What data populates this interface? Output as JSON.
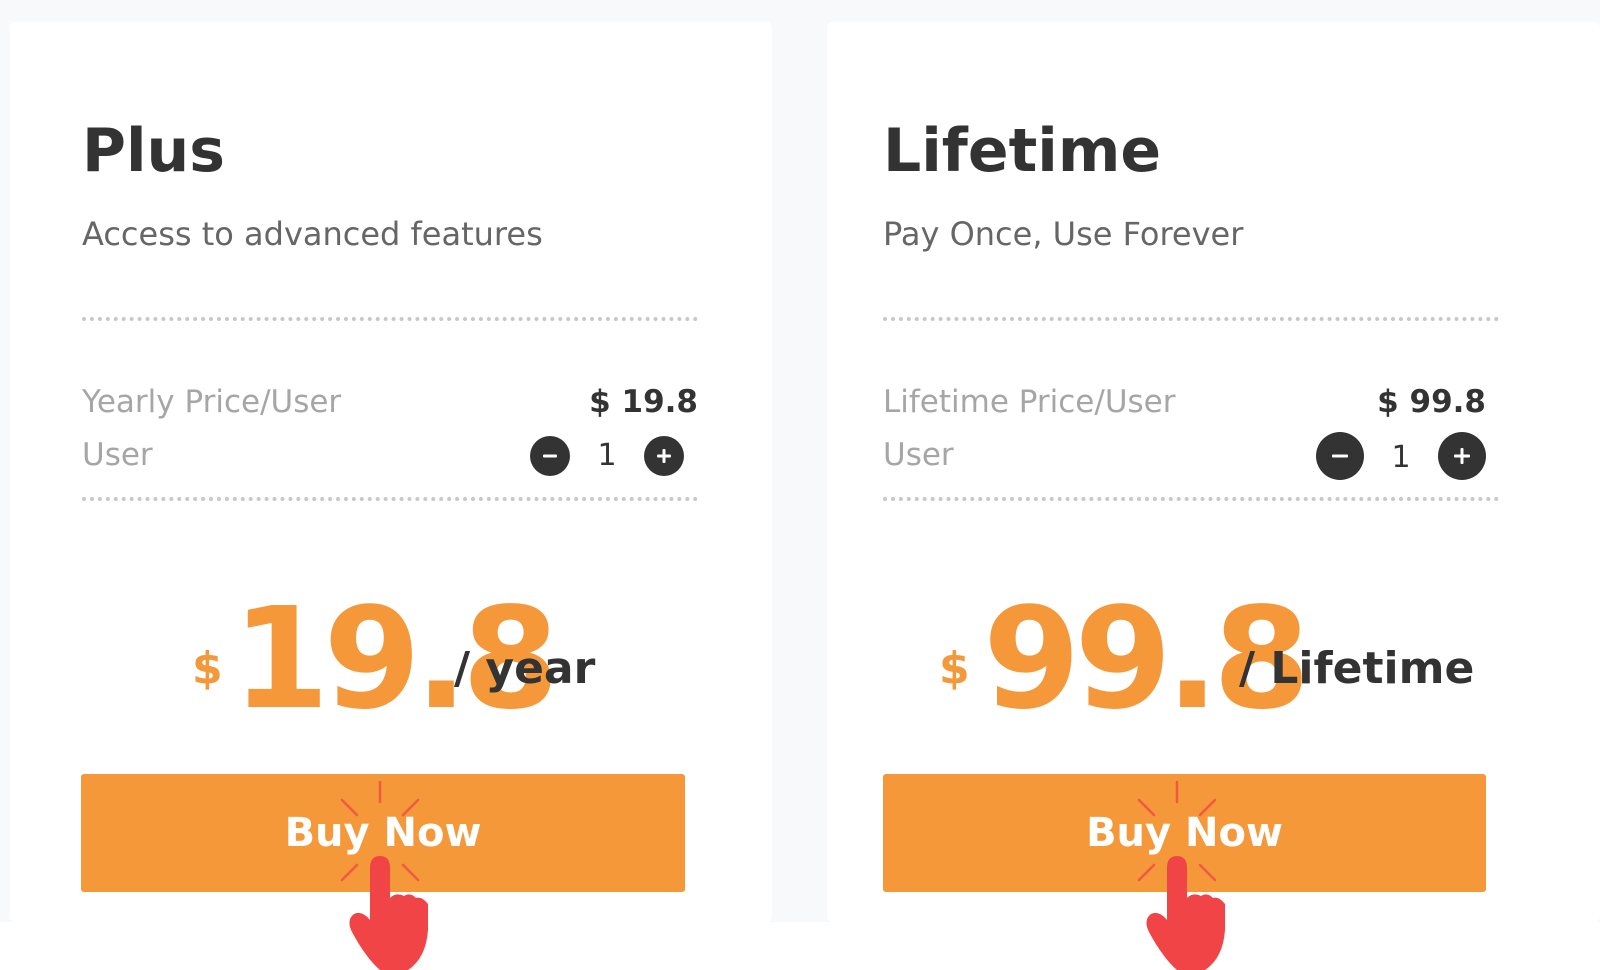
{
  "colors": {
    "accent": "#f4983a",
    "text_dark": "#333333",
    "text_muted": "#a6a6a6",
    "subtitle": "#666666",
    "pointer": "#f04446"
  },
  "plans": [
    {
      "title": "Plus",
      "subtitle": "Access to advanced features",
      "price_label": "Yearly Price/User",
      "price_value": "$ 19.8",
      "user_label": "User",
      "quantity": "1",
      "currency": "$",
      "amount": "19.8",
      "period": "/ year",
      "button_label": "Buy Now"
    },
    {
      "title": "Lifetime",
      "subtitle": "Pay Once, Use Forever",
      "price_label": "Lifetime Price/User",
      "price_value": "$ 99.8",
      "user_label": "User",
      "quantity": "1",
      "currency": "$",
      "amount": "99.8",
      "period": "/ Lifetime",
      "button_label": "Buy Now"
    }
  ],
  "icons": {
    "decrement": "minus-icon",
    "increment": "plus-icon",
    "cursor": "pointing-hand-icon"
  }
}
